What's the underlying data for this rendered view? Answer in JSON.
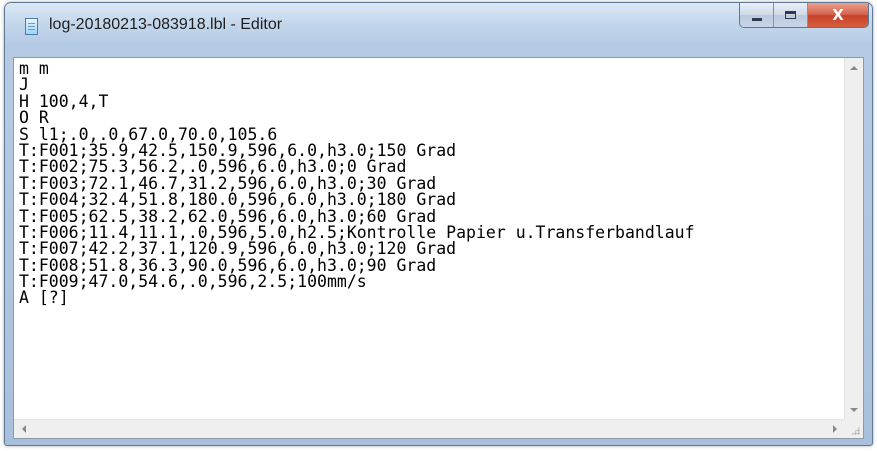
{
  "window": {
    "title": "log-20180213-083918.lbl - Editor",
    "controls": {
      "minimize_icon": "minimize-icon",
      "maximize_icon": "maximize-icon",
      "close_label": "X"
    }
  },
  "editor": {
    "lines": [
      "m m",
      "J",
      "H 100,4,T",
      "O R",
      "S l1;.0,.0,67.0,70.0,105.6",
      "T:F001;35.9,42.5,150.9,596,6.0,h3.0;150 Grad",
      "T:F002;75.3,56.2,.0,596,6.0,h3.0;0 Grad",
      "T:F003;72.1,46.7,31.2,596,6.0,h3.0;30 Grad",
      "T:F004;32.4,51.8,180.0,596,6.0,h3.0;180 Grad",
      "T:F005;62.5,38.2,62.0,596,6.0,h3.0;60 Grad",
      "T:F006;11.4,11.1,.0,596,5.0,h2.5;Kontrolle Papier u.Transferbandlauf",
      "T:F007;42.2,37.1,120.9,596,6.0,h3.0;120 Grad",
      "T:F008;51.8,36.3,90.0,596,6.0,h3.0;90 Grad",
      "T:F009;47.0,54.6,.0,596,2.5;100mm/s",
      "A [?]"
    ]
  },
  "colors": {
    "titlebar": "#c4d7ec",
    "close_button": "#c7412a",
    "text": "#000000"
  }
}
